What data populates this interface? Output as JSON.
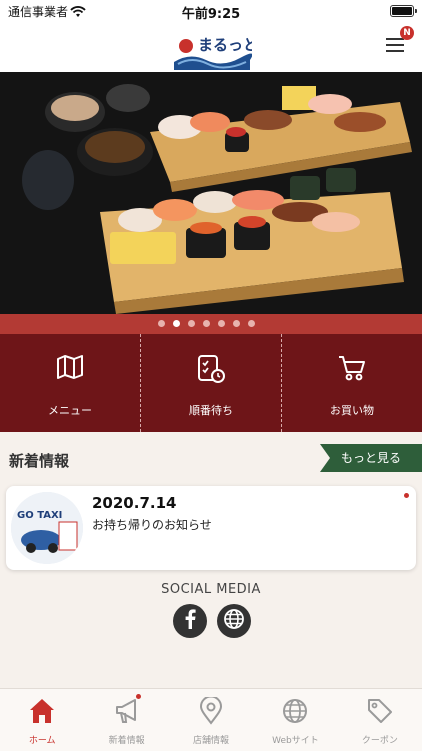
{
  "status_bar": {
    "carrier": "通信事業者",
    "time": "午前9:25"
  },
  "header": {
    "logo_text": "まるっと",
    "menu_badge": "N"
  },
  "hero": {
    "slide_count": 7,
    "active_slide": 2
  },
  "quick_nav": [
    {
      "label": "メニュー",
      "icon": "map-icon"
    },
    {
      "label": "順番待ち",
      "icon": "queue-clock-icon"
    },
    {
      "label": "お買い物",
      "icon": "cart-icon"
    }
  ],
  "news": {
    "section_title": "新着情報",
    "more_label": "もっと見る",
    "items": [
      {
        "date": "2020.7.14",
        "title": "お持ち帰りのお知らせ",
        "thumb_text": "GO TAXI",
        "unread": true
      }
    ]
  },
  "social": {
    "title": "SOCIAL MEDIA",
    "links": [
      {
        "icon": "facebook-icon"
      },
      {
        "icon": "globe-icon"
      }
    ]
  },
  "tab_bar": [
    {
      "label": "ホーム",
      "icon": "home-icon",
      "active": true
    },
    {
      "label": "新着情報",
      "icon": "megaphone-icon",
      "badge": true
    },
    {
      "label": "店舗情報",
      "icon": "location-pin-icon"
    },
    {
      "label": "Webサイト",
      "icon": "globe-icon"
    },
    {
      "label": "クーポン",
      "icon": "coupon-tag-icon"
    }
  ],
  "colors": {
    "brand_red": "#b33a34",
    "nav_dark_red": "#6e1518",
    "more_green": "#2e5e3a",
    "background": "#f6f1ec"
  }
}
